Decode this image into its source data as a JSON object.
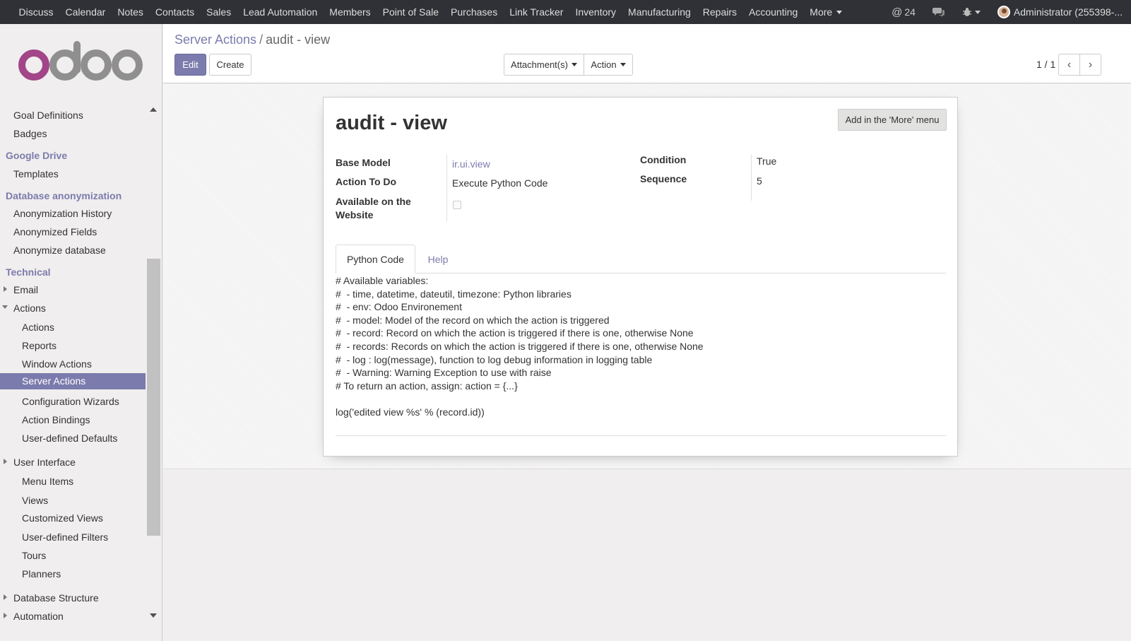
{
  "topbar": {
    "menu": [
      "Discuss",
      "Calendar",
      "Notes",
      "Contacts",
      "Sales",
      "Lead Automation",
      "Members",
      "Point of Sale",
      "Purchases",
      "Link Tracker",
      "Inventory",
      "Manufacturing",
      "Repairs",
      "Accounting"
    ],
    "more_label": "More",
    "mentions_count": "24",
    "user_label": "Administrator (255398-..."
  },
  "sidebar": {
    "logo_label": "odoo",
    "goal_definitions": "Goal Definitions",
    "badges": "Badges",
    "google_drive": "Google Drive",
    "templates": "Templates",
    "database_anonymization": "Database anonymization",
    "anonymization_history": "Anonymization History",
    "anonymized_fields": "Anonymized Fields",
    "anonymize_database": "Anonymize database",
    "technical": "Technical",
    "email": "Email",
    "actions": "Actions",
    "actions_sub": "Actions",
    "reports": "Reports",
    "window_actions": "Window Actions",
    "server_actions": "Server Actions",
    "configuration_wizards": "Configuration Wizards",
    "action_bindings": "Action Bindings",
    "user_defined_defaults": "User-defined Defaults",
    "user_interface": "User Interface",
    "menu_items": "Menu Items",
    "views": "Views",
    "customized_views": "Customized Views",
    "user_defined_filters": "User-defined Filters",
    "tours": "Tours",
    "planners": "Planners",
    "database_structure": "Database Structure",
    "automation": "Automation"
  },
  "control": {
    "breadcrumb_parent": "Server Actions",
    "breadcrumb_separator": "/",
    "breadcrumb_current": "audit - view",
    "edit_label": "Edit",
    "create_label": "Create",
    "attachments_label": "Attachment(s)",
    "action_label": "Action",
    "pager": "1 / 1"
  },
  "record": {
    "title": "audit - view",
    "more_menu_button": "Add in the 'More' menu",
    "base_model_label": "Base Model",
    "base_model_value": "ir.ui.view",
    "action_to_do_label": "Action To Do",
    "action_to_do_value": "Execute Python Code",
    "website_label_1": "Available on the",
    "website_label_2": "Website",
    "condition_label": "Condition",
    "condition_value": "True",
    "sequence_label": "Sequence",
    "sequence_value": "5",
    "tab_python": "Python Code",
    "tab_help": "Help",
    "code": "# Available variables:\n#  - time, datetime, dateutil, timezone: Python libraries\n#  - env: Odoo Environement\n#  - model: Model of the record on which the action is triggered\n#  - record: Record on which the action is triggered if there is one, otherwise None\n#  - records: Records on which the action is triggered if there is one, otherwise None\n#  - log : log(message), function to log debug information in logging table\n#  - Warning: Warning Exception to use with raise\n# To return an action, assign: action = {...}\n\nlog('edited view %s' % (record.id))"
  },
  "colors": {
    "brand": "#7c7bad",
    "navbar": "#2f3136"
  }
}
